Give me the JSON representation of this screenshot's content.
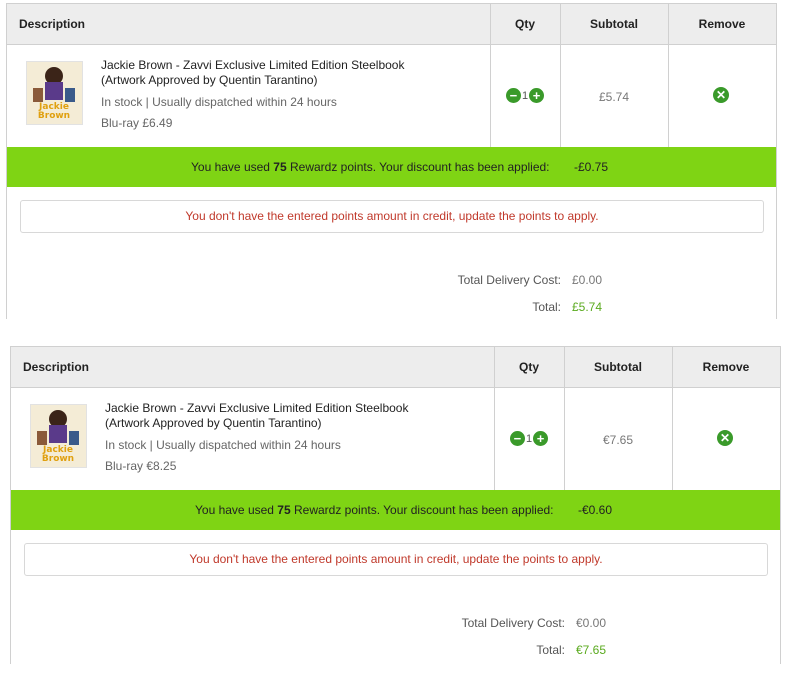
{
  "header": {
    "description": "Description",
    "qty": "Qty",
    "subtotal": "Subtotal",
    "remove": "Remove"
  },
  "cart_gbp": {
    "item": {
      "title": "Jackie Brown - Zavvi Exclusive Limited Edition Steelbook (Artwork Approved by Quentin Tarantino)",
      "stock": "In stock | Usually dispatched within 24 hours",
      "price": "Blu-ray £6.49",
      "qty": "1",
      "subtotal": "£5.74"
    },
    "rewards": {
      "prefix": "You have used ",
      "points": "75",
      "suffix": " Rewardz points. Your discount has been applied:",
      "discount": "-£0.75"
    },
    "warning": "You don't have the entered points amount in credit, update the points to apply.",
    "delivery_label": "Total Delivery Cost:",
    "delivery_value": "£0.00",
    "total_label": "Total:",
    "total_value": "£5.74"
  },
  "cart_eur": {
    "item": {
      "title": "Jackie Brown - Zavvi Exclusive Limited Edition Steelbook (Artwork Approved by Quentin Tarantino)",
      "stock": "In stock | Usually dispatched within 24 hours",
      "price": "Blu-ray €8.25",
      "qty": "1",
      "subtotal": "€7.65"
    },
    "rewards": {
      "prefix": "You have used ",
      "points": "75",
      "suffix": " Rewardz points. Your discount has been applied:",
      "discount": "-€0.60"
    },
    "warning": "You don't have the entered points amount in credit, update the points to apply.",
    "delivery_label": "Total Delivery Cost:",
    "delivery_value": "€0.00",
    "total_label": "Total:",
    "total_value": "€7.65"
  },
  "thumb_text": {
    "line1": "Jackie",
    "line2": "Brown"
  },
  "icons": {
    "minus": "minus-icon",
    "plus": "plus-icon",
    "remove": "close-icon"
  },
  "colors": {
    "accent_green": "#7fd414",
    "button_green": "#3a9a2a",
    "warning_red": "#c0392b",
    "total_green": "#5aaa1e"
  }
}
